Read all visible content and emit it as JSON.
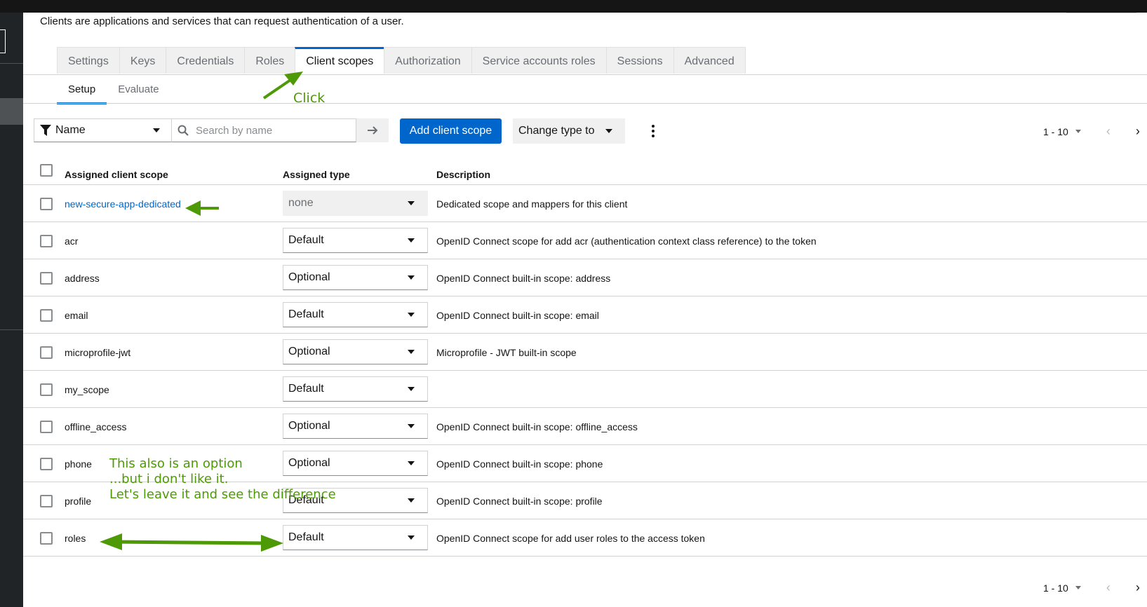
{
  "intro_text": "Clients are applications and services that can request authentication of a user.",
  "tabs": [
    {
      "label": "Settings"
    },
    {
      "label": "Keys"
    },
    {
      "label": "Credentials"
    },
    {
      "label": "Roles"
    },
    {
      "label": "Client scopes",
      "active": true
    },
    {
      "label": "Authorization"
    },
    {
      "label": "Service accounts roles"
    },
    {
      "label": "Sessions"
    },
    {
      "label": "Advanced"
    }
  ],
  "subtabs": [
    {
      "label": "Setup",
      "active": true
    },
    {
      "label": "Evaluate"
    }
  ],
  "toolbar": {
    "filter_label": "Name",
    "search_placeholder": "Search by name",
    "add_button": "Add client scope",
    "change_type": "Change type to"
  },
  "pagination": {
    "top_range": "1 - 10",
    "bottom_range": "1 - 10"
  },
  "table": {
    "headers": {
      "name": "Assigned client scope",
      "type": "Assigned type",
      "description": "Description"
    },
    "rows": [
      {
        "name": "new-secure-app-dedicated",
        "type": "none",
        "description": "Dedicated scope and mappers for this client"
      },
      {
        "name": "acr",
        "type": "Default",
        "description": "OpenID Connect scope for add acr (authentication context class reference) to the token"
      },
      {
        "name": "address",
        "type": "Optional",
        "description": "OpenID Connect built-in scope: address"
      },
      {
        "name": "email",
        "type": "Default",
        "description": "OpenID Connect built-in scope: email"
      },
      {
        "name": "microprofile-jwt",
        "type": "Optional",
        "description": "Microprofile - JWT built-in scope"
      },
      {
        "name": "my_scope",
        "type": "Default",
        "description": ""
      },
      {
        "name": "offline_access",
        "type": "Optional",
        "description": "OpenID Connect built-in scope: offline_access"
      },
      {
        "name": "phone",
        "type": "Optional",
        "description": "OpenID Connect built-in scope: phone"
      },
      {
        "name": "profile",
        "type": "Default",
        "description": "OpenID Connect built-in scope: profile"
      },
      {
        "name": "roles",
        "type": "Default",
        "description": "OpenID Connect scope for add user roles to the access token"
      }
    ]
  },
  "annotations": {
    "click": "Click",
    "option_lines": [
      "This also is an option",
      "...but i don't like it.",
      "Let's leave it and see the difference"
    ]
  },
  "colors": {
    "accent": "#0066cc",
    "annotation": "#4e9a06"
  }
}
